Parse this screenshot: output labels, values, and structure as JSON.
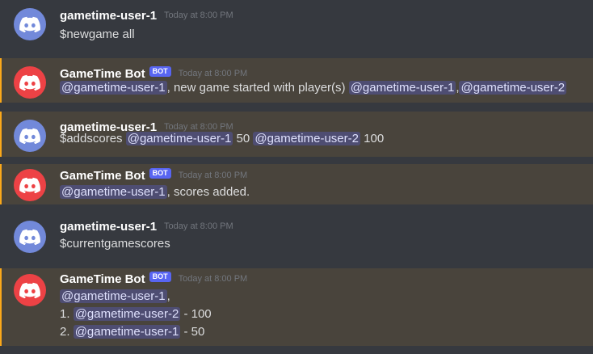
{
  "colors": {
    "background": "#36393f",
    "highlight": "#49443c",
    "highlight_bar": "#faa81a",
    "user_avatar": "#7289da",
    "bot_avatar": "#ed4245",
    "bot_tag": "#5865f2",
    "mention_text": "#dee0fc"
  },
  "messages": [
    {
      "author": "gametime-user-1",
      "timestamp": "Today at 8:00 PM",
      "line1": {
        "text": "$newgame all"
      }
    },
    {
      "author": "GameTime Bot",
      "bot_tag": "BOT",
      "timestamp": "Today at 8:00 PM",
      "line1": {
        "mention_a": "@gametime-user-1",
        "mid": ", new game started with player(s) ",
        "mention_b": "@gametime-user-1",
        "sep": ",",
        "mention_c": "@gametime-user-2"
      }
    },
    {
      "author": "gametime-user-1",
      "timestamp": "Today at 8:00 PM",
      "line1": {
        "cmd": "$addscores ",
        "mention_a": "@gametime-user-1",
        "score_a": " 50 ",
        "mention_b": "@gametime-user-2",
        "score_b": " 100"
      }
    },
    {
      "author": "GameTime Bot",
      "bot_tag": "BOT",
      "timestamp": "Today at 8:00 PM",
      "line1": {
        "mention_a": "@gametime-user-1",
        "rest": ", scores added."
      }
    },
    {
      "author": "gametime-user-1",
      "timestamp": "Today at 8:00 PM",
      "line1": {
        "text": "$currentgamescores"
      }
    },
    {
      "author": "GameTime Bot",
      "bot_tag": "BOT",
      "timestamp": "Today at 8:00 PM",
      "line1": {
        "mention_a": "@gametime-user-1",
        "rest": ","
      },
      "line2": {
        "prefix": "1. ",
        "mention": "@gametime-user-2",
        "suffix": " - 100"
      },
      "line3": {
        "prefix": "2. ",
        "mention": "@gametime-user-1",
        "suffix": " - 50"
      }
    }
  ]
}
